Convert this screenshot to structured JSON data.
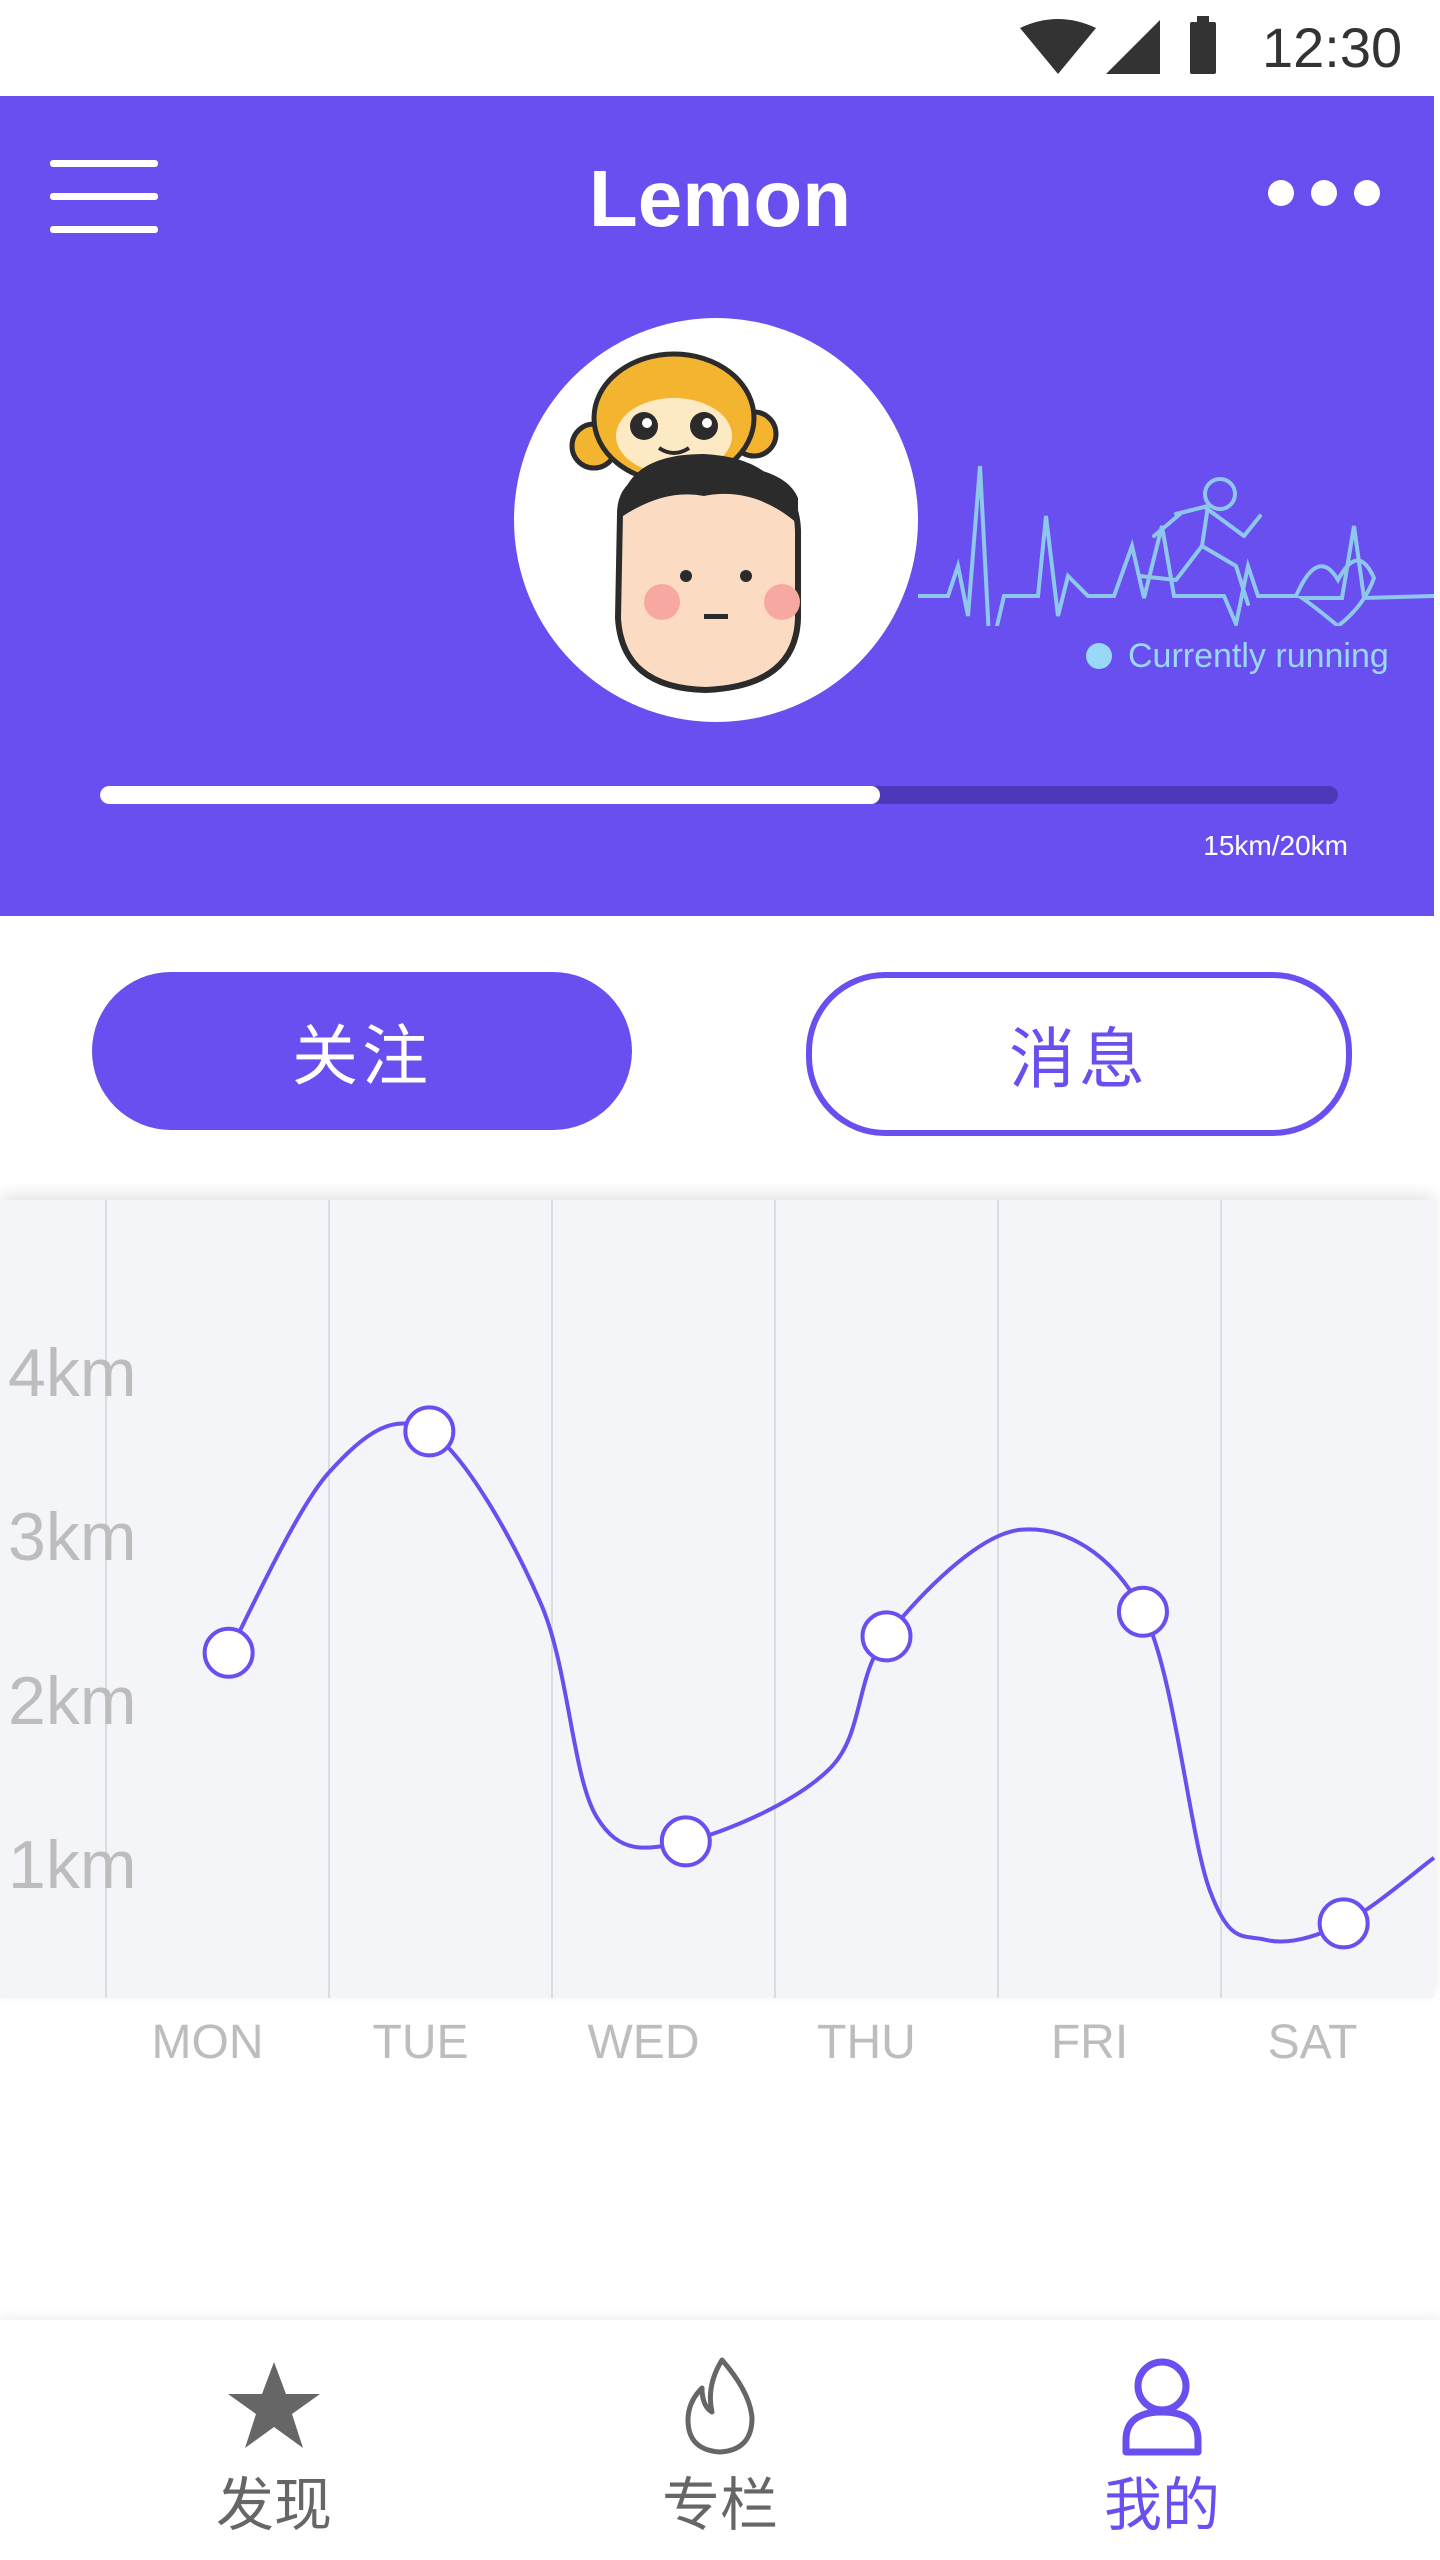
{
  "status_bar": {
    "time": "12:30",
    "icons": [
      "wifi-icon",
      "signal-icon",
      "battery-icon"
    ]
  },
  "header": {
    "title": "Lemon",
    "menu_icon": "hamburger-menu-icon",
    "more_icon": "more-dots-icon",
    "status_text": "Currently running",
    "progress": {
      "label": "15km/20km",
      "fraction": 0.63
    },
    "background_color": "#6a4ff0"
  },
  "actions": {
    "follow_label": "关注",
    "message_label": "消息"
  },
  "chart_data": {
    "type": "line",
    "categories": [
      "MON",
      "TUE",
      "WED",
      "THU",
      "FRI",
      "SAT"
    ],
    "y_tick_labels": [
      "4km",
      "3km",
      "2km",
      "1km"
    ],
    "y_ticks": [
      4,
      3,
      2,
      1
    ],
    "ylim": [
      0,
      5
    ],
    "points": [
      {
        "x": 0.55,
        "y": 2.3
      },
      {
        "x": 1.45,
        "y": 3.65
      },
      {
        "x": 2.6,
        "y": 1.15
      },
      {
        "x": 3.5,
        "y": 2.4
      },
      {
        "x": 4.65,
        "y": 2.55
      },
      {
        "x": 5.55,
        "y": 0.65
      }
    ],
    "line_color": "#6a4ff0",
    "grid": true
  },
  "bottom_nav": {
    "items": [
      {
        "label": "发现",
        "icon": "star-icon",
        "active": false
      },
      {
        "label": "专栏",
        "icon": "flame-icon",
        "active": false
      },
      {
        "label": "我的",
        "icon": "person-icon",
        "active": true
      }
    ],
    "active_color": "#6a4ff0",
    "inactive_color": "#666666"
  }
}
